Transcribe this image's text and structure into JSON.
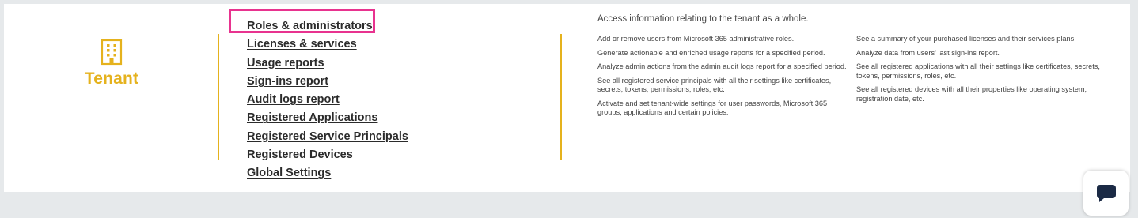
{
  "tenant": {
    "label": "Tenant",
    "icon": "building-icon",
    "accent_color": "#e5b21d"
  },
  "links": [
    {
      "label": "Roles & administrators",
      "highlighted": true
    },
    {
      "label": "Licenses & services"
    },
    {
      "label": "Usage reports"
    },
    {
      "label": "Sign-ins report"
    },
    {
      "label": "Audit logs report"
    },
    {
      "label": "Registered Applications"
    },
    {
      "label": "Registered Service Principals"
    },
    {
      "label": "Registered Devices"
    },
    {
      "label": "Global Settings"
    }
  ],
  "highlight_color": "#e8338f",
  "intro": "Access information relating to the tenant as a whole.",
  "descriptions": {
    "column1": [
      "Add or remove users from Microsoft 365 administrative roles.",
      "Generate actionable and enriched usage reports for a specified period.",
      "Analyze admin actions from the admin audit logs report for a specified period.",
      "See all registered service principals with all their settings like certificates, secrets, tokens, permissions, roles, etc.",
      "Activate and set tenant-wide settings for user passwords, Microsoft 365 groups, applications and certain policies."
    ],
    "column2": [
      "See a summary of your purchased licenses and their services plans.",
      "Analyze data from users' last sign-ins report.",
      "See all registered applications with all their settings like certificates, secrets, tokens, permissions, roles, etc.",
      "See all registered devices with all their properties like operating system, registration date, etc."
    ]
  },
  "chat": {
    "icon": "chat-bubble-icon"
  }
}
